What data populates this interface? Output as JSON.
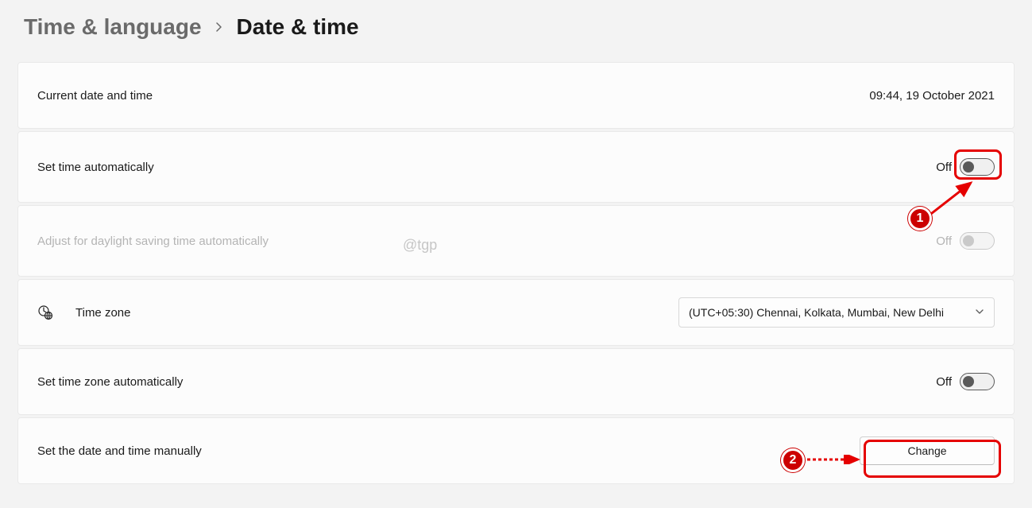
{
  "breadcrumb": {
    "prev": "Time & language",
    "current": "Date & time"
  },
  "rows": {
    "current": {
      "label": "Current date and time",
      "value": "09:44, 19 October 2021"
    },
    "auto_time": {
      "label": "Set time automatically",
      "state": "Off"
    },
    "dst": {
      "label": "Adjust for daylight saving time automatically",
      "state": "Off"
    },
    "timezone": {
      "label": "Time zone",
      "selected": "(UTC+05:30) Chennai, Kolkata, Mumbai, New Delhi"
    },
    "auto_tz": {
      "label": "Set time zone automatically",
      "state": "Off"
    },
    "manual": {
      "label": "Set the date and time manually",
      "button": "Change"
    }
  },
  "annotations": {
    "badge1": "1",
    "badge2": "2"
  },
  "watermark": "@tgp"
}
